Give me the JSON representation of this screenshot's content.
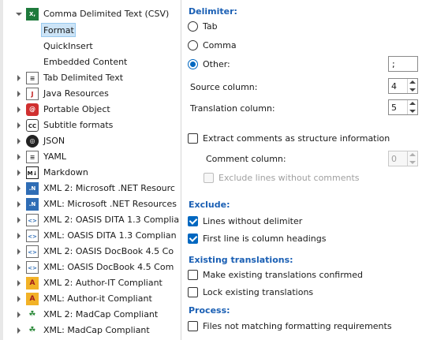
{
  "tree": {
    "items": [
      {
        "label": "Comma Delimited Text (CSV)",
        "icon": "csv-icon",
        "expander": "open"
      },
      {
        "label": "Format",
        "child": true,
        "selected": true
      },
      {
        "label": "QuickInsert",
        "child": true
      },
      {
        "label": "Embedded Content",
        "child": true
      },
      {
        "label": "Tab Delimited Text",
        "icon": "text-file-icon",
        "expander": "closed"
      },
      {
        "label": "Java Resources",
        "icon": "java-icon",
        "expander": "closed"
      },
      {
        "label": "Portable Object",
        "icon": "po-icon",
        "expander": "closed"
      },
      {
        "label": "Subtitle formats",
        "icon": "cc-icon",
        "expander": "closed"
      },
      {
        "label": "JSON",
        "icon": "json-icon",
        "expander": "closed"
      },
      {
        "label": "YAML",
        "icon": "yaml-icon",
        "expander": "closed"
      },
      {
        "label": "Markdown",
        "icon": "markdown-icon",
        "expander": "closed"
      },
      {
        "label": "XML 2: Microsoft .NET Resourc",
        "icon": "dotnet-icon",
        "expander": "closed"
      },
      {
        "label": "XML: Microsoft .NET Resources",
        "icon": "dotnet-icon",
        "expander": "closed"
      },
      {
        "label": "XML 2: OASIS DITA 1.3 Complia",
        "icon": "xml-file-icon",
        "expander": "closed"
      },
      {
        "label": "XML: OASIS DITA 1.3 Complian",
        "icon": "xml-file-icon",
        "expander": "closed"
      },
      {
        "label": "XML 2: OASIS DocBook 4.5 Co",
        "icon": "xml-file-icon",
        "expander": "closed"
      },
      {
        "label": "XML: OASIS DocBook 4.5 Com",
        "icon": "xml-file-icon",
        "expander": "closed"
      },
      {
        "label": "XML 2: Author-IT Compliant",
        "icon": "author-it-icon",
        "expander": "closed"
      },
      {
        "label": "XML: Author-it Compliant",
        "icon": "author-it-icon",
        "expander": "closed"
      },
      {
        "label": "XML 2: MadCap Compliant",
        "icon": "madcap-icon",
        "expander": "closed"
      },
      {
        "label": "XML: MadCap Compliant",
        "icon": "madcap-icon",
        "expander": "closed"
      }
    ]
  },
  "delimiter": {
    "title": "Delimiter:",
    "tab_label": "Tab",
    "comma_label": "Comma",
    "other_label": "Other:",
    "other_value": ";",
    "selected": "other"
  },
  "columns": {
    "source_label": "Source column:",
    "source_value": "4",
    "translation_label": "Translation column:",
    "translation_value": "5"
  },
  "comments": {
    "extract_label": "Extract comments as structure information",
    "extract_checked": false,
    "comment_column_label": "Comment column:",
    "comment_column_value": "0",
    "exclude_no_comments_label": "Exclude lines without comments"
  },
  "exclude": {
    "title": "Exclude:",
    "no_delimiter_label": "Lines without delimiter",
    "no_delimiter_checked": true,
    "first_line_label": "First line is column headings",
    "first_line_checked": true
  },
  "existing": {
    "title": "Existing translations:",
    "confirmed_label": "Make existing translations confirmed",
    "lock_label": "Lock existing translations"
  },
  "process": {
    "title": "Process:",
    "not_matching_label": "Files not matching formatting requirements"
  },
  "colors": {
    "accent": "#0067c0",
    "section": "#1a5fb4",
    "selection": "#cce4f7"
  }
}
